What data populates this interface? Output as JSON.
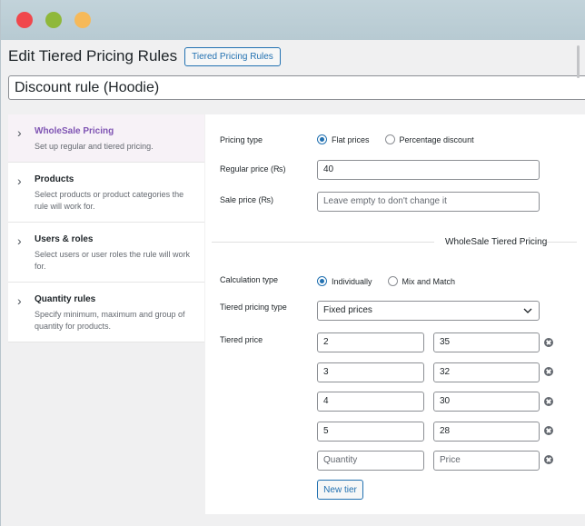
{
  "header": {
    "title": "Edit Tiered Pricing Rules",
    "title_button": "Tiered Pricing Rules",
    "rule_name": "Discount rule (Hoodie)"
  },
  "sidebar": {
    "items": [
      {
        "title": "WholeSale Pricing",
        "desc": "Set up regular and tiered pricing.",
        "active": true
      },
      {
        "title": "Products",
        "desc": "Select products or product categories the rule will work for."
      },
      {
        "title": "Users & roles",
        "desc": "Select users or user roles the rule will work for."
      },
      {
        "title": "Quantity rules",
        "desc": "Specify minimum, maximum and group of quantity for products."
      }
    ]
  },
  "form": {
    "pricing_type": {
      "label": "Pricing type",
      "options": [
        "Flat prices",
        "Percentage discount"
      ],
      "selected": "Flat prices"
    },
    "regular_price": {
      "label": "Regular price (₨)",
      "value": "40"
    },
    "sale_price": {
      "label": "Sale price (₨)",
      "placeholder": "Leave empty to don't change it"
    },
    "section_title": "WholeSale Tiered Pricing",
    "calculation_type": {
      "label": "Calculation type",
      "options": [
        "Individually",
        "Mix and Match"
      ],
      "selected": "Individually"
    },
    "tiered_pricing_type": {
      "label": "Tiered pricing type",
      "value": "Fixed prices"
    },
    "tiered_price": {
      "label": "Tiered price",
      "tiers": [
        {
          "quantity": "2",
          "price": "35"
        },
        {
          "quantity": "3",
          "price": "32"
        },
        {
          "quantity": "4",
          "price": "30"
        },
        {
          "quantity": "5",
          "price": "28"
        }
      ],
      "quantity_placeholder": "Quantity",
      "price_placeholder": "Price",
      "new_tier_label": "New tier"
    }
  },
  "colors": {
    "accent": "#2271b1",
    "sidebar_active": "#7f54b3",
    "close": "#f0474c",
    "minimize": "#8fb83a",
    "maximize": "#f6b959"
  }
}
